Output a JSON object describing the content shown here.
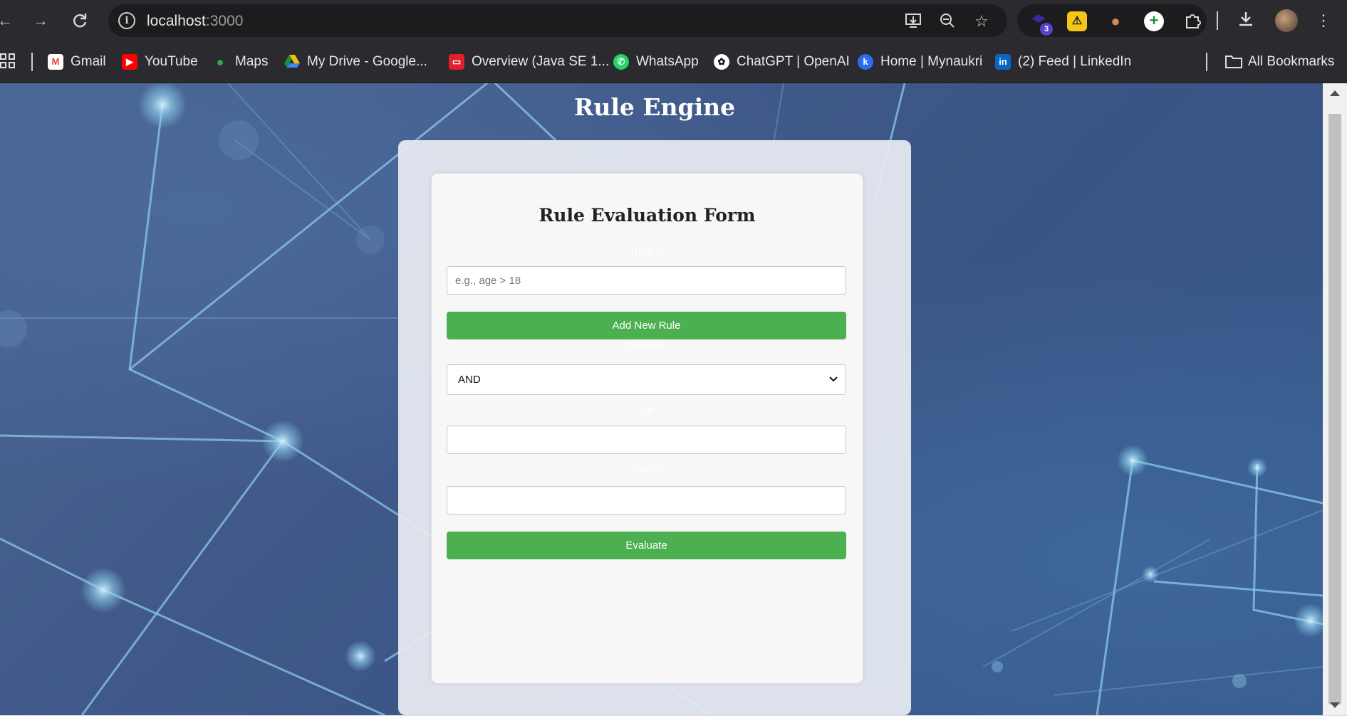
{
  "browser": {
    "url_host": "localhost",
    "url_port": ":3000",
    "extension_badge": "3",
    "icons": {
      "back": "arrow-left-icon",
      "forward": "arrow-right-icon",
      "reload": "reload-icon",
      "site_info": "info-icon",
      "install": "install-app-icon",
      "zoom": "zoom-out-icon",
      "bookmark": "star-icon",
      "downloads": "download-icon",
      "menu": "kebab-menu-icon"
    }
  },
  "bookmarks": [
    {
      "label": "Gmail",
      "icon": "gmail-icon",
      "color": "#ea4335"
    },
    {
      "label": "YouTube",
      "icon": "youtube-icon",
      "color": "#ff0000"
    },
    {
      "label": "Maps",
      "icon": "maps-icon",
      "color": "#34a853"
    },
    {
      "label": "My Drive - Google...",
      "icon": "google-drive-icon",
      "color": "#fbbc04"
    },
    {
      "label": "Overview (Java SE 1...",
      "icon": "oracle-icon",
      "color": "#e0202c"
    },
    {
      "label": "WhatsApp",
      "icon": "whatsapp-icon",
      "color": "#25d366"
    },
    {
      "label": "ChatGPT | OpenAI",
      "icon": "openai-icon",
      "color": "#ffffff"
    },
    {
      "label": "Home | Mynaukri",
      "icon": "mynaukri-icon",
      "color": "#2b6cf0"
    },
    {
      "label": "(2) Feed | LinkedIn",
      "icon": "linkedin-icon",
      "color": "#0a66c2"
    }
  ],
  "all_bookmarks": "All Bookmarks",
  "page": {
    "title": "Rule Engine",
    "form": {
      "title": "Rule Evaluation Form",
      "rule_label": "Rule 1:",
      "rule_placeholder": "e.g., age > 18",
      "add_rule_button": "Add New Rule",
      "operator_label": "Operator:",
      "operator_value": "AND",
      "age_label": "Age:",
      "age_value": "",
      "salary_label": "Salary:",
      "salary_value": "",
      "evaluate_button": "Evaluate"
    },
    "colors": {
      "button_green": "#4caf50",
      "background_blue": "#40598a"
    }
  }
}
